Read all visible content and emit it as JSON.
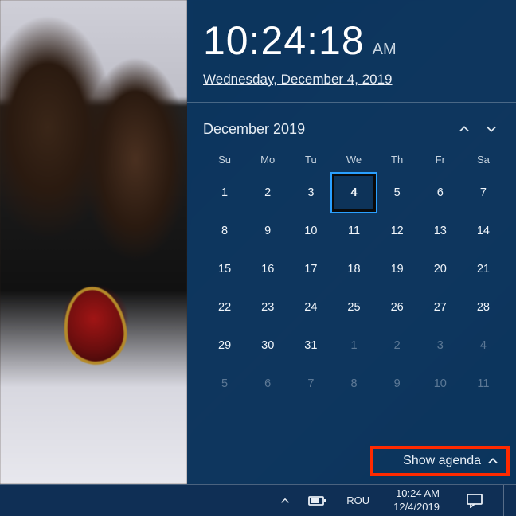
{
  "clock": {
    "time": "10:24:18",
    "ampm": "AM",
    "date_full": "Wednesday, December 4, 2019"
  },
  "calendar": {
    "month_label": "December 2019",
    "dow": [
      "Su",
      "Mo",
      "Tu",
      "We",
      "Th",
      "Fr",
      "Sa"
    ],
    "today_day": 4,
    "weeks": [
      [
        {
          "n": 1
        },
        {
          "n": 2
        },
        {
          "n": 3
        },
        {
          "n": 4,
          "today": true
        },
        {
          "n": 5
        },
        {
          "n": 6
        },
        {
          "n": 7
        }
      ],
      [
        {
          "n": 8
        },
        {
          "n": 9
        },
        {
          "n": 10
        },
        {
          "n": 11
        },
        {
          "n": 12
        },
        {
          "n": 13
        },
        {
          "n": 14
        }
      ],
      [
        {
          "n": 15
        },
        {
          "n": 16
        },
        {
          "n": 17
        },
        {
          "n": 18
        },
        {
          "n": 19
        },
        {
          "n": 20
        },
        {
          "n": 21
        }
      ],
      [
        {
          "n": 22
        },
        {
          "n": 23
        },
        {
          "n": 24
        },
        {
          "n": 25
        },
        {
          "n": 26
        },
        {
          "n": 27
        },
        {
          "n": 28
        }
      ],
      [
        {
          "n": 29
        },
        {
          "n": 30
        },
        {
          "n": 31
        },
        {
          "n": 1,
          "dim": true
        },
        {
          "n": 2,
          "dim": true
        },
        {
          "n": 3,
          "dim": true
        },
        {
          "n": 4,
          "dim": true
        }
      ],
      [
        {
          "n": 5,
          "dim": true
        },
        {
          "n": 6,
          "dim": true
        },
        {
          "n": 7,
          "dim": true
        },
        {
          "n": 8,
          "dim": true
        },
        {
          "n": 9,
          "dim": true
        },
        {
          "n": 10,
          "dim": true
        },
        {
          "n": 11,
          "dim": true
        }
      ]
    ]
  },
  "agenda": {
    "label": "Show agenda"
  },
  "taskbar": {
    "lang": "ROU",
    "time": "10:24 AM",
    "date": "12/4/2019"
  }
}
